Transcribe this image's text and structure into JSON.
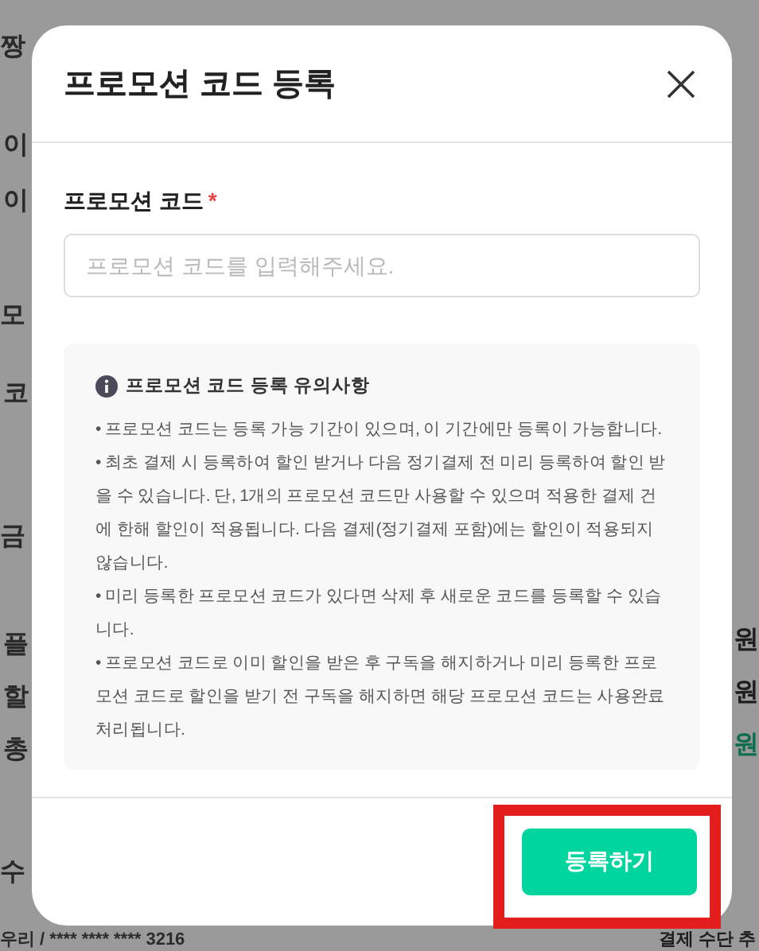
{
  "background": {
    "left_fragments": [
      "짱",
      "이",
      "이",
      "모",
      "코",
      "금",
      "플",
      "할",
      "총",
      "수",
      "우리 / **** **** **** 3216"
    ],
    "right_fragments": [
      {
        "text": "원",
        "highlight": false
      },
      {
        "text": "원",
        "highlight": false
      },
      {
        "text": "원",
        "highlight": true
      },
      {
        "text": "결제 수단 추",
        "highlight": false
      }
    ]
  },
  "dialog": {
    "title": "프로모션 코드 등록",
    "field": {
      "label": "프로모션 코드",
      "required_mark": "*",
      "placeholder": "프로모션 코드를 입력해주세요."
    },
    "notice": {
      "title": "프로모션 코드 등록 유의사항",
      "items": [
        "• 프로모션 코드는 등록 가능 기간이 있으며, 이 기간에만 등록이 가능합니다.",
        "• 최초 결제 시 등록하여 할인 받거나 다음 정기결제 전 미리 등록하여 할인 받을 수 있습니다. 단, 1개의 프로모션 코드만 사용할 수 있으며 적용한 결제 건에 한해 할인이 적용됩니다. 다음 결제(정기결제 포함)에는 할인이 적용되지 않습니다.",
        "• 미리 등록한 프로모션 코드가 있다면 삭제 후 새로운 코드를 등록할 수 있습니다.",
        "• 프로모션 코드로 이미 할인을 받은 후 구독을 해지하거나 미리 등록한 프로모션 코드로 할인을 받기 전 구독을 해지하면 해당 프로모션 코드는 사용완료 처리됩니다."
      ]
    },
    "submit_button": {
      "label": "등록하기",
      "highlighted": true
    }
  }
}
